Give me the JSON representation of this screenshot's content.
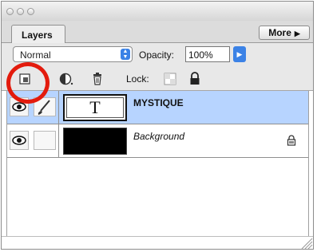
{
  "panel": {
    "tab_label": "Layers",
    "more_label": "More",
    "blend_mode": "Normal",
    "opacity_label": "Opacity:",
    "opacity_value": "100%",
    "lock_label": "Lock:"
  },
  "layers": [
    {
      "name": "MYSTIQUE",
      "thumbnail_text": "T",
      "selected": true,
      "locked": false
    },
    {
      "name": "Background",
      "thumbnail_text": "",
      "selected": false,
      "locked": true
    }
  ],
  "colors": {
    "selection": "#b7d4ff",
    "highlight_ring": "#e31b0d",
    "accent": "#3b82e6"
  },
  "icons": [
    "new-layer-icon",
    "adjustment-layer-icon",
    "trash-icon",
    "lock-transparent-icon",
    "lock-all-icon",
    "eye-icon",
    "brush-icon",
    "resize-grip-icon"
  ]
}
